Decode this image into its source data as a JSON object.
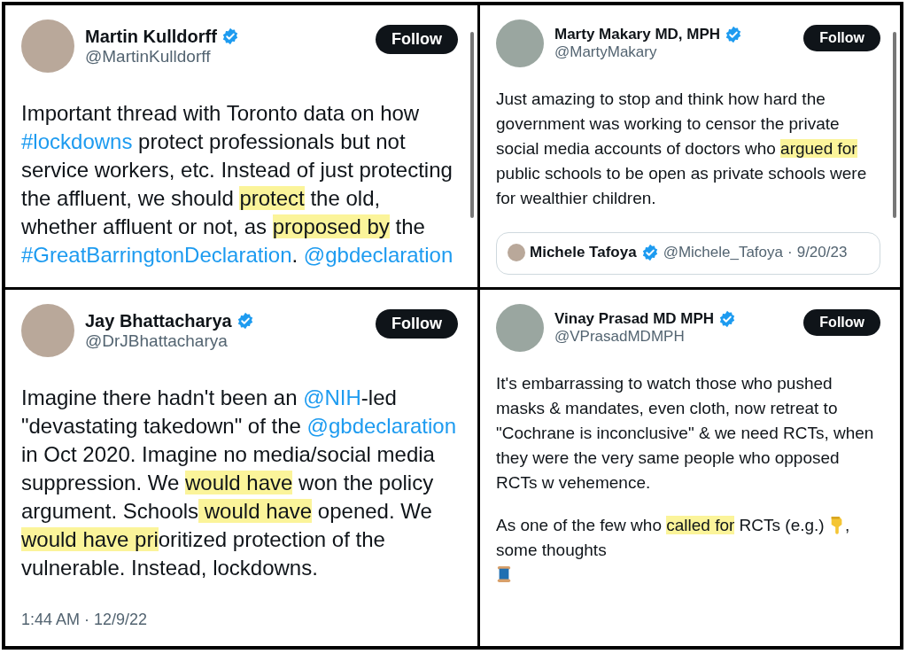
{
  "tweets": [
    {
      "name": "Martin Kulldorff",
      "handle": "@MartinKulldorff",
      "verified": true,
      "follow": "Follow",
      "paragraphs": [
        [
          {
            "kind": "plain",
            "text": "Important thread with Toronto data on how "
          },
          {
            "kind": "link",
            "text": "#lockdowns"
          },
          {
            "kind": "plain",
            "text": " protect professionals but not service workers, etc. Instead of just protecting the affluent, we should "
          },
          {
            "kind": "highlight",
            "text": "protect"
          },
          {
            "kind": "plain",
            "text": " the old, whether affluent or not, as "
          },
          {
            "kind": "highlight",
            "text": "proposed by"
          },
          {
            "kind": "plain",
            "text": " the "
          },
          {
            "kind": "link",
            "text": "#GreatBarringtonDeclaration"
          },
          {
            "kind": "plain",
            "text": ". "
          },
          {
            "kind": "link",
            "text": "@gbdeclaration"
          }
        ]
      ]
    },
    {
      "name": "Marty Makary MD, MPH",
      "handle": "@MartyMakary",
      "verified": true,
      "follow": "Follow",
      "paragraphs": [
        [
          {
            "kind": "plain",
            "text": "Just amazing to stop and think how hard the government was working to censor the private social media accounts of doctors who "
          },
          {
            "kind": "highlight",
            "text": "argued for"
          },
          {
            "kind": "plain",
            "text": " public schools to be open as private schools were for wealthier children."
          }
        ]
      ],
      "quote": {
        "name": "Michele Tafoya",
        "verified": true,
        "handle": "@Michele_Tafoya",
        "separator": "·",
        "date": "9/20/23"
      }
    },
    {
      "name": "Jay Bhattacharya",
      "handle": "@DrJBhattacharya",
      "verified": true,
      "follow": "Follow",
      "paragraphs": [
        [
          {
            "kind": "plain",
            "text": "Imagine there hadn't been an "
          },
          {
            "kind": "link",
            "text": "@NIH"
          },
          {
            "kind": "plain",
            "text": "-led \"devastating takedown\" of the "
          },
          {
            "kind": "link",
            "text": "@gbdeclaration"
          },
          {
            "kind": "plain",
            "text": " in Oct 2020. Imagine no media/social media suppression. We "
          },
          {
            "kind": "highlight",
            "text": "would have"
          },
          {
            "kind": "plain",
            "text": " won the policy argument. Schools"
          },
          {
            "kind": "highlight",
            "text": " would have"
          },
          {
            "kind": "plain",
            "text": " opened. We "
          },
          {
            "kind": "highlight",
            "text": "would have pri"
          },
          {
            "kind": "plain",
            "text": "oritized protection of the vulnerable. Instead, lockdowns."
          }
        ]
      ],
      "timestamp": "1:44 AM · 12/9/22"
    },
    {
      "name": "Vinay Prasad MD MPH",
      "handle": "@VPrasadMDMPH",
      "verified": true,
      "follow": "Follow",
      "paragraphs": [
        [
          {
            "kind": "plain",
            "text": "It's embarrassing to watch those who pushed masks &  mandates, even cloth, now retreat to \"Cochrane is inconclusive\" & we need RCTs, when they were the very same people who opposed RCTs w vehemence."
          }
        ],
        [
          {
            "kind": "plain",
            "text": "As one of the few who "
          },
          {
            "kind": "highlight",
            "text": "called for"
          },
          {
            "kind": "plain",
            "text": " RCTs (e.g.) "
          },
          {
            "kind": "pointing-down-emoji"
          },
          {
            "kind": "plain",
            "text": ", some thoughts"
          },
          {
            "kind": "spool-emoji"
          }
        ]
      ]
    }
  ]
}
